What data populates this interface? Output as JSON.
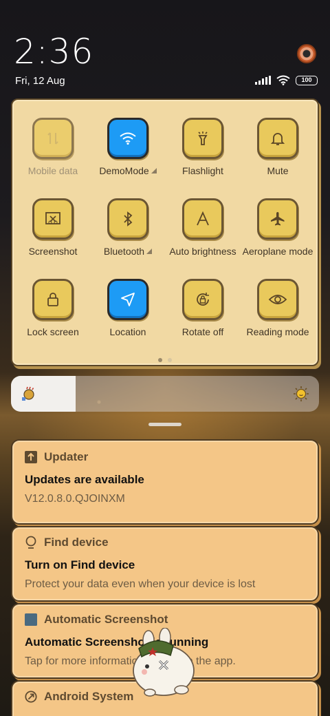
{
  "status": {
    "time": "2:36",
    "date": "Fri, 12 Aug",
    "battery": "100"
  },
  "quick_settings": {
    "tiles": [
      {
        "label": "Mobile data",
        "icon": "mobile-data-icon",
        "state": "disabled"
      },
      {
        "label": "DemoMode",
        "icon": "wifi-icon",
        "state": "active",
        "expandable": true
      },
      {
        "label": "Flashlight",
        "icon": "flashlight-icon",
        "state": "off"
      },
      {
        "label": "Mute",
        "icon": "bell-icon",
        "state": "off"
      },
      {
        "label": "Screenshot",
        "icon": "screenshot-icon",
        "state": "off"
      },
      {
        "label": "Bluetooth",
        "icon": "bluetooth-icon",
        "state": "off",
        "expandable": true
      },
      {
        "label": "Auto brightness",
        "icon": "auto-brightness-icon",
        "state": "off"
      },
      {
        "label": "Aeroplane mode",
        "icon": "airplane-icon",
        "state": "off"
      },
      {
        "label": "Lock screen",
        "icon": "lock-icon",
        "state": "off"
      },
      {
        "label": "Location",
        "icon": "location-icon",
        "state": "active"
      },
      {
        "label": "Rotate off",
        "icon": "rotate-lock-icon",
        "state": "off"
      },
      {
        "label": "Reading mode",
        "icon": "eye-icon",
        "state": "off"
      }
    ],
    "page": 1,
    "page_count": 2
  },
  "brightness": {
    "level": 0.21
  },
  "notifications": [
    {
      "app": "Updater",
      "icon": "upload-arrow-icon",
      "title": "Updates are available",
      "body": "V12.0.8.0.QJOINXM"
    },
    {
      "app": "Find device",
      "icon": "location-pin-icon",
      "title": "Turn on Find device",
      "body": "Protect your data even when your device is lost"
    },
    {
      "app": "Automatic Screenshot",
      "icon": "square-app-icon",
      "title": "Automatic Screenshot is running",
      "body": "Tap for more information or to stop the app."
    },
    {
      "app": "Android System",
      "icon": "android-system-icon",
      "title": "",
      "body": ""
    }
  ],
  "colors": {
    "panel": "#f1d9a3",
    "tile": "#e9c95c",
    "tile_active": "#1d9bf5",
    "card": "#f4c687"
  }
}
